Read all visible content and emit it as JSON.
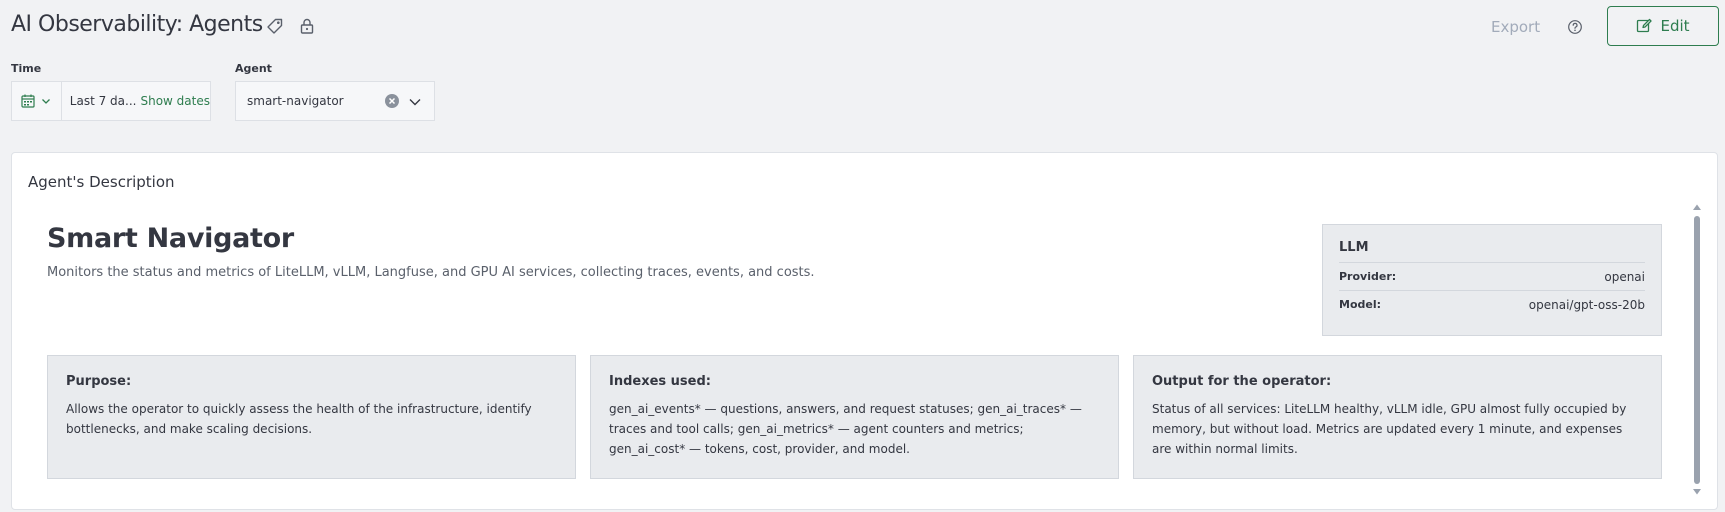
{
  "header": {
    "title": "AI Observability: Agents",
    "export_label": "Export",
    "edit_label": "Edit",
    "icons": [
      "tag-icon",
      "lock-icon",
      "help-icon",
      "pencil-icon"
    ]
  },
  "filters": {
    "time_label": "Time",
    "time_value": "Last 7 da...",
    "show_dates": "Show dates",
    "agent_label": "Agent",
    "agent_value": "smart-navigator"
  },
  "panel": {
    "title": "Agent's Description",
    "agent_name": "Smart Navigator",
    "agent_description": "Monitors the status and metrics of LiteLLM, vLLM, Langfuse, and GPU AI services, collecting traces, events, and costs.",
    "llm": {
      "title": "LLM",
      "provider_label": "Provider:",
      "provider_value": "openai",
      "model_label": "Model:",
      "model_value": "openai/gpt-oss-20b"
    },
    "cards": [
      {
        "title": "Purpose:",
        "text": "Allows the operator to quickly assess the health of the infrastructure, identify bottlenecks, and make scaling decisions."
      },
      {
        "title": "Indexes used:",
        "text": "gen_ai_events* — questions, answers, and request statuses; gen_ai_traces* — traces and tool calls; gen_ai_metrics* — agent counters and metrics; gen_ai_cost* — tokens, cost, provider, and model."
      },
      {
        "title": "Output for the operator:",
        "text": "Status of all services: LiteLLM healthy, vLLM idle, GPU almost fully occupied by memory, but without load. Metrics are updated every 1 minute, and expenses are within normal limits."
      }
    ]
  },
  "colors": {
    "accent": "#2e7d4f",
    "background": "#f1f2f4",
    "card": "#e9ebee",
    "muted_text": "#a2abba"
  }
}
